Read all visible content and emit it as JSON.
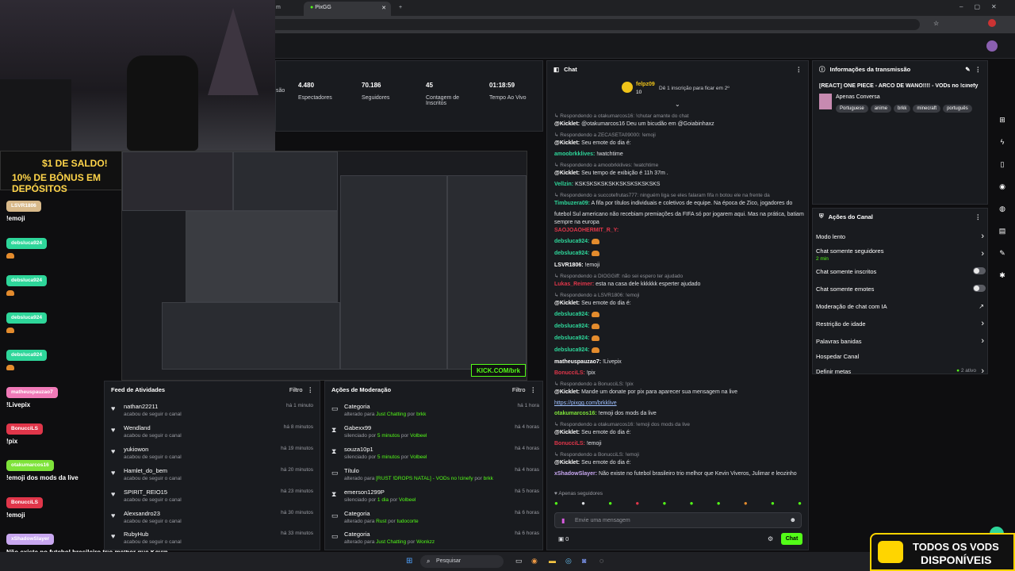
{
  "browser": {
    "tabs": [
      {
        "label": "m"
      },
      {
        "label": "PixGG"
      }
    ],
    "new_tab": "+"
  },
  "stats": [
    {
      "value": "",
      "label": "são"
    },
    {
      "value": "4.480",
      "label": "Espectadores"
    },
    {
      "value": "70.186",
      "label": "Seguidores"
    },
    {
      "value": "45",
      "label": "Contagem de Inscritos"
    },
    {
      "value": "01:18:59",
      "label": "Tempo Ao Vivo"
    }
  ],
  "promo": {
    "line1": "$1 DE SALDO!",
    "line2": "10% DE BÔNUS EM DEPÓSITOS"
  },
  "preview": {
    "watermark": "KICK.COM/brk"
  },
  "overlay_chat": [
    {
      "user": "LSVR1806",
      "msg": "!emoji",
      "color": "#d8b98a"
    },
    {
      "user": "debsluca924",
      "msg": "",
      "color": "#2ed69a"
    },
    {
      "user": "debsluca924",
      "msg": "",
      "color": "#2ed69a"
    },
    {
      "user": "debsluca924",
      "msg": "",
      "color": "#2ed69a"
    },
    {
      "user": "debsluca924",
      "msg": "",
      "color": "#2ed69a"
    },
    {
      "user": "matheuspauzao7",
      "msg": "!Livepix",
      "color": "#f07ab8"
    },
    {
      "user": "BonucciLS",
      "msg": "!pix",
      "color": "#e0364a"
    },
    {
      "user": "otakumarcos16",
      "msg": "!emoji dos mods da live",
      "color": "#7ee33a"
    },
    {
      "user": "BonucciLS",
      "msg": "!emoji",
      "color": "#e0364a"
    },
    {
      "user": "xShadowSlayer",
      "msg": "Não existe no futebol brasileiro trio melhor que Kevin Viveros, Julimar e leozinho",
      "color": "#c8a7f0"
    }
  ],
  "feed": {
    "title": "Feed de Atividades",
    "filter": "Filtro",
    "items": [
      {
        "name": "nathan22211",
        "action": "acabou de seguir o canal",
        "time": "há 1 minuto"
      },
      {
        "name": "Wendland",
        "action": "acabou de seguir o canal",
        "time": "há 8 minutos"
      },
      {
        "name": "yukiowon",
        "action": "acabou de seguir o canal",
        "time": "há 19 minutos"
      },
      {
        "name": "Hamlet_do_bem",
        "action": "acabou de seguir o canal",
        "time": "há 20 minutos"
      },
      {
        "name": "SPIRIT_REIO15",
        "action": "acabou de seguir o canal",
        "time": "há 23 minutos"
      },
      {
        "name": "Alexsandro23",
        "action": "acabou de seguir o canal",
        "time": "há 30 minutos"
      },
      {
        "name": "RubyHub",
        "action": "acabou de seguir o canal",
        "time": "há 33 minutos"
      }
    ]
  },
  "mod": {
    "title": "Ações de Moderação",
    "filter": "Filtro",
    "items": [
      {
        "title": "Categoria",
        "pre": "alterado para ",
        "hl": "Just Chatting",
        "mid": " por ",
        "by": "brkk",
        "time": "há 1 hora"
      },
      {
        "title": "Gabexx99",
        "pre": "silenciado por ",
        "hl": "5 minutos",
        "mid": " por ",
        "by": "Volbeel",
        "time": "há 4 horas"
      },
      {
        "title": "souza10p1",
        "pre": "silenciado por ",
        "hl": "5 minutos",
        "mid": " por ",
        "by": "Volbeel",
        "time": "há 4 horas"
      },
      {
        "title": "Título",
        "pre": "alterado para ",
        "hl": "[RUST !DROPS NATAL] - VODs no !cinefy",
        "mid": " por ",
        "by": "brkk",
        "time": "há 4 horas"
      },
      {
        "title": "emerson1299P",
        "pre": "silenciado por ",
        "hl": "1 dia",
        "mid": " por ",
        "by": "Volbeel",
        "time": "há 5 horas"
      },
      {
        "title": "Categoria",
        "pre": "alterado para ",
        "hl": "Rust",
        "mid": " por ",
        "by": "tudocorte",
        "time": "há 6 horas"
      },
      {
        "title": "Categoria",
        "pre": "alterado para ",
        "hl": "Just Chatting",
        "mid": " por ",
        "by": "Wonkzz",
        "time": "há 6 horas"
      }
    ]
  },
  "chat": {
    "title": "Chat",
    "pinned_user": "felpz09",
    "pinned_count": "10",
    "pinned_text": "Dê 1 inscrição para ficar em 2º",
    "lines": [
      {
        "type": "reply",
        "text": "Respondendo a otakumarcos16: !chutar amante do chat"
      },
      {
        "type": "msg",
        "user": "@Kicklet:",
        "ucolor": "#fff",
        "text": " @otakumarcos16 Deu um bicudão em @Goiabinhaxz"
      },
      {
        "type": "reply",
        "text": "Respondendo a ZECASETA09000: !emoji"
      },
      {
        "type": "msg",
        "user": "@Kicklet:",
        "ucolor": "#fff",
        "text": " Seu emote do dia é:"
      },
      {
        "type": "msg",
        "user": "amoobrkklives:",
        "ucolor": "#2ed69a",
        "text": " !watchtime"
      },
      {
        "type": "reply",
        "text": "Respondendo a amoobrkklives: !watchtime"
      },
      {
        "type": "msg",
        "user": "@Kicklet:",
        "ucolor": "#fff",
        "text": " Seu tempo de exibição é 11h 37m ."
      },
      {
        "type": "msg",
        "user": "Vellzin:",
        "ucolor": "#2ed69a",
        "text": " KSKSKSKSKSKKSKSKSKSKSKS"
      },
      {
        "type": "reply",
        "text": "Respondendo a succotefrutas777: ninguém liga se eles falaram fifa n botou ele na frente da"
      },
      {
        "type": "msg",
        "user": "Timbuzera09:",
        "ucolor": "#2ed69a",
        "text": " A fifa por títulos individuais e coletivos de equipe. Na época de Zico, jogadores do"
      },
      {
        "type": "cont",
        "text": "futebol Sul americano não recebiam premiações da FIFA só por jogarem aqui. Mas na prática, batiam"
      },
      {
        "type": "cont",
        "text": "sempre na europa"
      },
      {
        "type": "msg",
        "user": "SAOJOAOHERMIT_R_Y:",
        "ucolor": "#e0364a",
        "text": ""
      },
      {
        "type": "burger",
        "user": "debsluca924:",
        "ucolor": "#2ed69a"
      },
      {
        "type": "burger",
        "user": "debsluca924:",
        "ucolor": "#2ed69a"
      },
      {
        "type": "msg",
        "user": "LSVR1806:",
        "ucolor": "#fff",
        "text": " !emoji"
      },
      {
        "type": "reply",
        "text": "Respondendo a DIOGGiff: não sei espero ter ajudado"
      },
      {
        "type": "msg",
        "user": "Lukas_Reimer:",
        "ucolor": "#e0364a",
        "text": " esta na casa dele kkkkkk esperter ajudado"
      },
      {
        "type": "reply",
        "text": "Respondendo a LSVR1806: !emoji"
      },
      {
        "type": "msg",
        "user": "@Kicklet:",
        "ucolor": "#fff",
        "text": " Seu emote do dia é:"
      },
      {
        "type": "burger",
        "user": "debsluca924:",
        "ucolor": "#2ed69a"
      },
      {
        "type": "burger",
        "user": "debsluca924:",
        "ucolor": "#2ed69a"
      },
      {
        "type": "burger",
        "user": "debsluca924:",
        "ucolor": "#2ed69a"
      },
      {
        "type": "burger",
        "user": "debsluca924:",
        "ucolor": "#2ed69a"
      },
      {
        "type": "msg",
        "user": "matheuspauzao7:",
        "ucolor": "#fff",
        "text": " !Livepix"
      },
      {
        "type": "msg",
        "user": "BonucciLS:",
        "ucolor": "#e0364a",
        "text": " !pix"
      },
      {
        "type": "reply",
        "text": "Respondendo a BonucciLS: !pix"
      },
      {
        "type": "msg",
        "user": "@Kicklet:",
        "ucolor": "#fff",
        "text": " Mande um donate por pix para aparecer sua mensagem na live"
      },
      {
        "type": "link",
        "text": "https://pixgg.com/brkklive"
      },
      {
        "type": "msg",
        "user": "otakumarcos16:",
        "ucolor": "#7ee33a",
        "text": " !emoji dos mods da live"
      },
      {
        "type": "reply",
        "text": "Respondendo a otakumarcos16: !emoji dos mods da live"
      },
      {
        "type": "msg",
        "user": "@Kicklet:",
        "ucolor": "#fff",
        "text": " Seu emote do dia é:"
      },
      {
        "type": "msg",
        "user": "BonucciLS:",
        "ucolor": "#e0364a",
        "text": " !emoji"
      },
      {
        "type": "reply",
        "text": "Respondendo a BonucciLS: !emoji"
      },
      {
        "type": "msg",
        "user": "@Kicklet:",
        "ucolor": "#fff",
        "text": " Seu emote do dia é:"
      },
      {
        "type": "msg",
        "user": "xShadowSlayer:",
        "ucolor": "#c8a7f0",
        "text": " Não existe no futebol brasileiro trio melhor que Kevin Viveros, Julimar e leozinho"
      }
    ],
    "followers_only": "Apenas seguidores",
    "input_placeholder": "Envie uma mensagem",
    "points": "0",
    "send_label": "Chat"
  },
  "stream_info": {
    "title": "Informações da transmissão",
    "stream_title": "[REACT] ONE PIECE - ARCO DE WANO!!!! - VODs no !cinefy",
    "category": "Apenas Conversa",
    "tags": [
      "Portuguese",
      "anime",
      "brkk",
      "minecraft",
      "português"
    ]
  },
  "channel_actions": {
    "title": "Ações do Canal",
    "slow_mode": "Modo lento",
    "followers_only": "Chat somente seguidores",
    "followers_only_value": "2 min",
    "subs_only": "Chat somente inscritos",
    "emotes_only": "Chat somente emotes",
    "ai_mod": "Moderação de chat com IA",
    "age_restriction": "Restrição de idade",
    "banned_words": "Palavras banidas",
    "host": "Hospedar Canal",
    "goals": "Definir metas",
    "goals_value": "2 ativo"
  },
  "taskbar": {
    "search": "Pesquisar"
  },
  "vods_banner": {
    "line1": "TODOS OS VODS",
    "line2": "DISPONÍVEIS"
  },
  "colors": {
    "accent": "#53fc18",
    "panel": "#191b1f",
    "bg": "#0e0e10"
  }
}
